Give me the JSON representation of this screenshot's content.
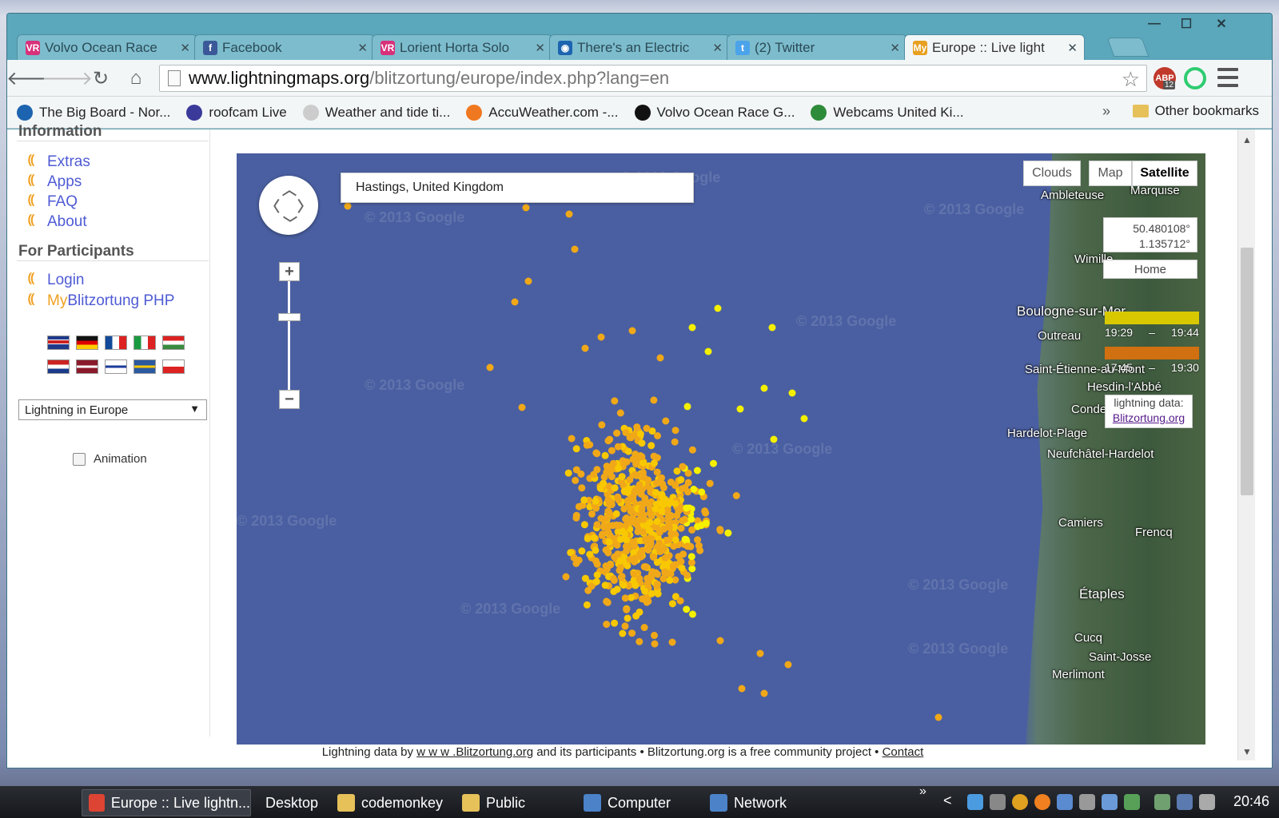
{
  "window_controls": {
    "minimize": "—",
    "maximize": "☐",
    "close": "✕"
  },
  "tabs": [
    {
      "title": "Volvo Ocean Race",
      "icon": "VR",
      "color": "#d9307a",
      "active": false
    },
    {
      "title": "Facebook",
      "icon": "f",
      "color": "#3b5998",
      "active": false
    },
    {
      "title": "Lorient Horta Solo",
      "icon": "VR",
      "color": "#d9307a",
      "active": false
    },
    {
      "title": "There's an Electric",
      "icon": "◉",
      "color": "#1d64b0",
      "active": false
    },
    {
      "title": "(2) Twitter",
      "icon": "t",
      "color": "#4ba3ea",
      "active": false
    },
    {
      "title": "Europe :: Live light",
      "icon": "My",
      "color": "#e8a020",
      "active": true
    }
  ],
  "tab_close": "✕",
  "toolbar": {
    "url_host": "www.lightningmaps.org",
    "url_path": "/blitzortung/europe/index.php?lang=en",
    "abp_label": "ABP",
    "abp_count": "12"
  },
  "bookmarks": [
    {
      "label": "The Big Board - Nor...",
      "color": "#1d64b0"
    },
    {
      "label": "roofcam Live",
      "color": "#3a3a9a"
    },
    {
      "label": "Weather and tide ti...",
      "color": "#cccccc"
    },
    {
      "label": "AccuWeather.com -...",
      "color": "#f07820"
    },
    {
      "label": "Volvo Ocean Race G...",
      "color": "#111111"
    },
    {
      "label": "Webcams United Ki...",
      "color": "#2e8b3a"
    }
  ],
  "bookmarks_more": "»",
  "bookmarks_other": "Other bookmarks",
  "sidebar": {
    "info_heading": "Information",
    "info_links": [
      "Extras",
      "Apps",
      "FAQ",
      "About"
    ],
    "participants_heading": "For Participants",
    "login": "Login",
    "my_prefix": "My",
    "my_rest": "Blitzortung PHP",
    "region_select": "Lightning in Europe",
    "animation_label": "Animation"
  },
  "map": {
    "search_value": "Hastings, United Kingdom",
    "map_types": [
      "Clouds",
      "Map",
      "Satellite"
    ],
    "selected_map_type": "Satellite",
    "coord_lat": "50.480108°",
    "coord_lon": "1.135712°",
    "home_label": "Home",
    "legend": [
      {
        "from": "19:29",
        "to": "19:44",
        "color": "#d8c800"
      },
      {
        "from": "17:45",
        "to": "19:30",
        "color": "#d07010"
      }
    ],
    "legend_sep": "–",
    "credit_label": "lightning data:",
    "credit_link": "Blitzortung.org",
    "watermark": "© 2013 Google",
    "towns": [
      "Ambleteuse",
      "Marquise",
      "Wimille",
      "Boulogne-sur-Mer",
      "Outreau",
      "Saint-Étienne-au-Mont",
      "Hesdin-l'Abbé",
      "Condette",
      "Hardelot-Plage",
      "Neufchâtel-Hardelot",
      "Camiers",
      "Frencq",
      "Étaples",
      "Cucq",
      "Saint-Josse",
      "Merlimont"
    ],
    "strike_colors": {
      "old": "#f0a818",
      "mid": "#f8c800",
      "new": "#f4f000"
    },
    "zoom_in": "+",
    "zoom_out": "−"
  },
  "footer": {
    "prefix": "Lightning data by ",
    "link": "w w w .Blitzortung.org",
    "middle": " and its participants • Blitzortung.org is a free community project • ",
    "contact": "Contact"
  },
  "taskbar": {
    "items": [
      {
        "label": "Europe :: Live lightn...",
        "active": true,
        "color": "#dd4433"
      },
      {
        "label": "Desktop",
        "active": false,
        "color": ""
      },
      {
        "label": "codemonkey",
        "active": false,
        "color": "#e6c15a"
      },
      {
        "label": "Public",
        "active": false,
        "color": "#e6c15a"
      },
      {
        "label": "Computer",
        "active": false,
        "color": "#4b82c8"
      },
      {
        "label": "Network",
        "active": false,
        "color": "#4b82c8"
      }
    ],
    "overflow": "»",
    "tray_left": "<",
    "clock": "20:46"
  }
}
